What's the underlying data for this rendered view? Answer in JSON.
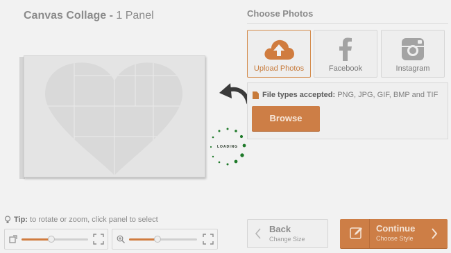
{
  "product": {
    "title_bold": "Canvas Collage -",
    "title_light": " 1 Panel"
  },
  "loading": {
    "label": "LOADING"
  },
  "tip": {
    "label": "Tip:",
    "text": " to rotate or zoom, click panel to select"
  },
  "sliders": {
    "rotate": {
      "icon": "rotate-icon",
      "level": 0.45
    },
    "zoom": {
      "icon": "zoom-in-icon",
      "level": 0.42
    }
  },
  "choose_photos": {
    "heading": "Choose Photos",
    "sources": [
      {
        "label": "Upload Photos",
        "icon": "cloud-upload-icon"
      },
      {
        "label": "Facebook",
        "icon": "facebook-icon"
      },
      {
        "label": "Instagram",
        "icon": "instagram-icon"
      }
    ]
  },
  "file_types": {
    "label": "File types accepted:",
    "list": " PNG, JPG, GIF, BMP and TIF"
  },
  "browse_label": "Browse",
  "nav": {
    "back_label": "Back",
    "back_sub": "Change Size",
    "continue_label": "Continue",
    "continue_sub": "Choose Style"
  },
  "colors": {
    "accent": "#cd7e46",
    "spinner": "#1f7a2a",
    "background": "#f2f2f2"
  }
}
